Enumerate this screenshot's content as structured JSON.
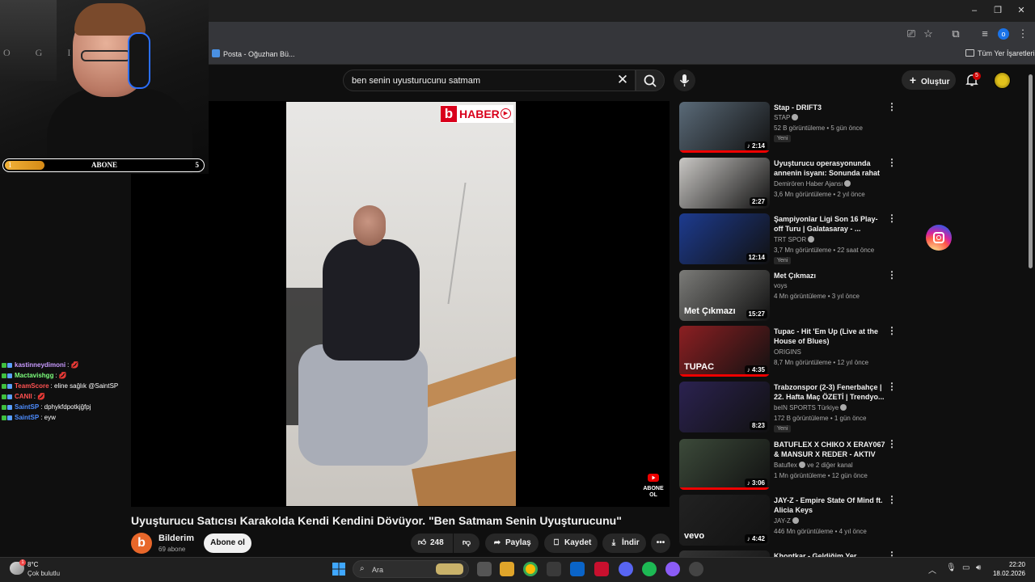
{
  "browser": {
    "bookmarks": [
      {
        "label": "Posta - Oğuzhan Bü..."
      },
      {
        "label": "Tüm Yer İşaretleri"
      }
    ],
    "profile_initial": "o"
  },
  "stream": {
    "webcam_text": "O G I",
    "sub_goal": {
      "label": "ABONE",
      "current": "1",
      "target": "5",
      "progress": 0.2
    },
    "chat": [
      {
        "name": "kastinneydimoni",
        "msg": ": 💋",
        "color": "#c99bff"
      },
      {
        "name": "Mactavishgg",
        "msg": ": 💋",
        "color": "#7dff7d"
      },
      {
        "name": "TeamScore",
        "msg": ": eline sağlık @SaintSP",
        "color": "#ff5252"
      },
      {
        "name": "CANII",
        "msg": ": 💋",
        "color": "#ff4f4f"
      },
      {
        "name": "SaintSP",
        "msg": ": dphykfdpotkjğfpj",
        "color": "#4d8dff"
      },
      {
        "name": "SaintSP",
        "msg": ": eyw",
        "color": "#4d8dff"
      }
    ]
  },
  "youtube": {
    "search_query": "ben senin uyusturucunu satmam",
    "create_label": "Oluştur",
    "notifications": "5",
    "video": {
      "title": "Uyuşturucu Satıcısı Karakolda Kendi Kendini Dövüyor. \"Ben Satmam Senin Uyuşturucunu\"",
      "watermark": "HABER",
      "abone_overlay": "ABONE OL",
      "channel": "Bilderim",
      "channel_initial": "b",
      "subscribers": "69 abone",
      "subscribe_label": "Abone ol",
      "likes": "248",
      "share_label": "Paylaş",
      "save_label": "Kaydet",
      "download_label": "İndir"
    },
    "recommendations": [
      {
        "title": "Stap - DRIFT3",
        "channel": "STAP",
        "verified": true,
        "meta": "52 B görüntüleme • 5 gün önce",
        "new": "Yeni",
        "duration": "2:14",
        "music": true,
        "thumb": "#5a6a78",
        "progress": 1
      },
      {
        "title": "Uyuşturucu operasyonunda annenin isyanı: Sonunda rahat ...",
        "channel": "Demirören Haber Ajansı",
        "verified": true,
        "meta": "3,6 Mn görüntüleme • 2 yıl önce",
        "new": "",
        "duration": "2:27",
        "music": false,
        "thumb": "#c9c7c4",
        "progress": 0
      },
      {
        "title": "Şampiyonlar Ligi Son 16 Play-off Turu | Galatasaray - ...",
        "channel": "TRT SPOR",
        "verified": true,
        "meta": "3,7 Mn görüntüleme • 22 saat önce",
        "new": "Yeni",
        "duration": "12:14",
        "music": false,
        "thumb": "#1d3b8f",
        "progress": 0
      },
      {
        "title": "Met Çıkmazı",
        "channel": "voys",
        "verified": false,
        "meta": "4 Mn görüntüleme • 3 yıl önce",
        "new": "",
        "duration": "15:27",
        "music": false,
        "thumb": "#7b7b78",
        "thumb_text": "Met Çıkmazı",
        "progress": 0
      },
      {
        "title": "Tupac - Hit 'Em Up (Live at the House of Blues)",
        "channel": "ORIGINS",
        "verified": false,
        "meta": "8,7 Mn görüntüleme • 12 yıl önce",
        "new": "",
        "duration": "4:35",
        "music": true,
        "thumb": "#8c1f22",
        "thumb_text": "TUPAC",
        "progress": 1
      },
      {
        "title": "Trabzonspor (2-3) Fenerbahçe | 22. Hafta Maç ÖZETİ | Trendyo...",
        "channel": "beIN SPORTS Türkiye",
        "verified": true,
        "meta": "172 B görüntüleme • 1 gün önce",
        "new": "Yeni",
        "duration": "8:23",
        "music": false,
        "thumb": "#2b2250",
        "progress": 0
      },
      {
        "title": "BATUFLEX X CHIKO X ERAY067 & MANSUR X REDER - AKTIV II...",
        "channel": "Batuflex",
        "channel_extra": "ve 2 diğer kanal",
        "verified": true,
        "meta": "1 Mn görüntüleme • 12 gün önce",
        "new": "",
        "duration": "3:06",
        "music": true,
        "thumb": "#3c4a3a",
        "progress": 1
      },
      {
        "title": "JAY-Z - Empire State Of Mind ft. Alicia Keys",
        "channel": "JAY-Z",
        "verified": true,
        "meta": "446 Mn görüntüleme • 4 yıl önce",
        "new": "",
        "duration": "4:42",
        "music": true,
        "thumb": "#222",
        "thumb_text": "vevo",
        "progress": 0
      },
      {
        "title": "Khontkar - Geldiğim Yer",
        "channel": "",
        "verified": false,
        "meta": "",
        "new": "",
        "duration": "",
        "music": false,
        "thumb": "#333",
        "progress": 0
      }
    ]
  },
  "taskbar": {
    "temp": "8°C",
    "condition": "Çok bulutlu",
    "weather_badge": "1",
    "search_placeholder": "Ara",
    "time": "22:20",
    "date": "18.02.2026"
  }
}
